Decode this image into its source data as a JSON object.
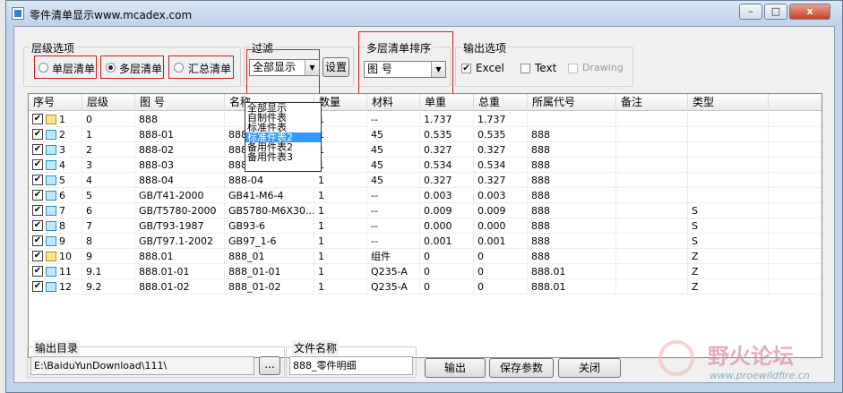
{
  "window": {
    "title": "零件清单显示www.mcadex.com",
    "minimize": "–",
    "maximize": "□",
    "close": "x"
  },
  "level_options": {
    "label": "层级选项",
    "single": "单层清单",
    "multi": "多层清单",
    "summary": "汇总清单",
    "selected": "multi"
  },
  "filter": {
    "label": "过滤",
    "value": "全部显示",
    "button": "设置",
    "options": [
      "全部显示",
      "自制件表",
      "标准件表",
      "标准件表2",
      "备用件表2",
      "备用件表3"
    ],
    "highlighted": "标准件表2"
  },
  "sort": {
    "label": "多层清单排序",
    "value": "图 号"
  },
  "output_options": {
    "label": "输出选项",
    "excel": "Excel",
    "excel_checked": true,
    "text": "Text",
    "text_checked": false,
    "drawing": "Drawing",
    "drawing_checked": false
  },
  "table": {
    "columns": [
      "序号",
      "层级",
      "图 号",
      "名称",
      "数量",
      "材料",
      "单重",
      "总重",
      "所属代号",
      "备注",
      "类型"
    ],
    "rows": [
      {
        "no": "1",
        "level": "0",
        "code": "888",
        "name": "",
        "qty": "1",
        "mat": "--",
        "uw": "1.737",
        "tw": "1.737",
        "parent": "",
        "note": "",
        "type": "",
        "asm": true
      },
      {
        "no": "2",
        "level": "1",
        "code": "888-01",
        "name": "888",
        "qty": "1",
        "mat": "45",
        "uw": "0.535",
        "tw": "0.535",
        "parent": "888",
        "note": "",
        "type": "",
        "asm": false
      },
      {
        "no": "3",
        "level": "2",
        "code": "888-02",
        "name": "888-02",
        "qty": "1",
        "mat": "45",
        "uw": "0.327",
        "tw": "0.327",
        "parent": "888",
        "note": "",
        "type": "",
        "asm": false
      },
      {
        "no": "4",
        "level": "3",
        "code": "888-03",
        "name": "888-03",
        "qty": "1",
        "mat": "45",
        "uw": "0.534",
        "tw": "0.534",
        "parent": "888",
        "note": "",
        "type": "",
        "asm": false
      },
      {
        "no": "5",
        "level": "4",
        "code": "888-04",
        "name": "888-04",
        "qty": "1",
        "mat": "45",
        "uw": "0.327",
        "tw": "0.327",
        "parent": "888",
        "note": "",
        "type": "",
        "asm": false
      },
      {
        "no": "6",
        "level": "5",
        "code": "GB/T41-2000",
        "name": "GB41-M6-4",
        "qty": "1",
        "mat": "--",
        "uw": "0.003",
        "tw": "0.003",
        "parent": "888",
        "note": "",
        "type": "",
        "asm": false
      },
      {
        "no": "7",
        "level": "6",
        "code": "GB/T5780-2000",
        "name": "GB5780-M6X30...",
        "qty": "1",
        "mat": "--",
        "uw": "0.009",
        "tw": "0.009",
        "parent": "888",
        "note": "",
        "type": "S",
        "asm": false
      },
      {
        "no": "8",
        "level": "7",
        "code": "GB/T93-1987",
        "name": "GB93-6",
        "qty": "1",
        "mat": "--",
        "uw": "0.000",
        "tw": "0.000",
        "parent": "888",
        "note": "",
        "type": "S",
        "asm": false
      },
      {
        "no": "9",
        "level": "8",
        "code": "GB/T97.1-2002",
        "name": "GB97_1-6",
        "qty": "1",
        "mat": "--",
        "uw": "0.001",
        "tw": "0.001",
        "parent": "888",
        "note": "",
        "type": "S",
        "asm": false
      },
      {
        "no": "10",
        "level": "9",
        "code": "888.01",
        "name": "888_01",
        "qty": "1",
        "mat": "组件",
        "uw": "0",
        "tw": "0",
        "parent": "888",
        "note": "",
        "type": "Z",
        "asm": true
      },
      {
        "no": "11",
        "level": "9.1",
        "code": "888.01-01",
        "name": "888_01-01",
        "qty": "1",
        "mat": "Q235-A",
        "uw": "0",
        "tw": "0",
        "parent": "888.01",
        "note": "",
        "type": "Z",
        "asm": false
      },
      {
        "no": "12",
        "level": "9.2",
        "code": "888.01-02",
        "name": "888_01-02",
        "qty": "1",
        "mat": "Q235-A",
        "uw": "0",
        "tw": "0",
        "parent": "888.01",
        "note": "",
        "type": "Z",
        "asm": false
      }
    ]
  },
  "bottom": {
    "out_dir_label": "输出目录",
    "out_dir_value": "E:\\BaiduYunDownload\\111\\",
    "browse": "...",
    "file_name_label": "文件名称",
    "file_name_value": "888_零件明细",
    "output_button": "输出",
    "save_params_button": "保存参数",
    "close_button": "关闭"
  },
  "watermark": {
    "text": "野火论坛",
    "url": "www.proewildfire.cn"
  }
}
